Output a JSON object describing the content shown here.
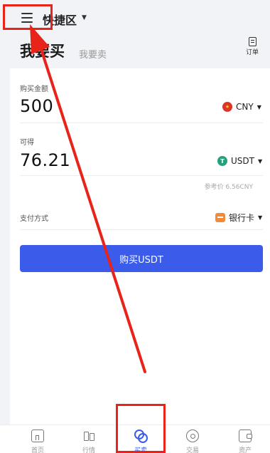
{
  "header": {
    "title": "快捷区"
  },
  "tabs": {
    "buy_label": "我要买",
    "sell_label": "我要卖",
    "orders_label": "订单"
  },
  "form": {
    "amount_label": "购买金额",
    "amount_value": "500",
    "amount_currency": "CNY",
    "receive_label": "可得",
    "receive_value": "76.21",
    "receive_currency": "USDT",
    "reference_price": "参考价 6.56CNY",
    "payment_label": "支付方式",
    "payment_value": "银行卡",
    "buy_button": "购买USDT"
  },
  "bottom_nav": {
    "items": [
      {
        "icon": "home-icon",
        "label": "首页"
      },
      {
        "icon": "candlestick-icon",
        "label": "行情"
      },
      {
        "icon": "exchange-icon",
        "label": "买卖"
      },
      {
        "icon": "trade-icon",
        "label": "交易"
      },
      {
        "icon": "wallet-icon",
        "label": "资产"
      }
    ],
    "active_index": 2
  },
  "colors": {
    "accent": "#3b5bea",
    "annotation": "#e8231a",
    "background": "#f2f3f7"
  }
}
